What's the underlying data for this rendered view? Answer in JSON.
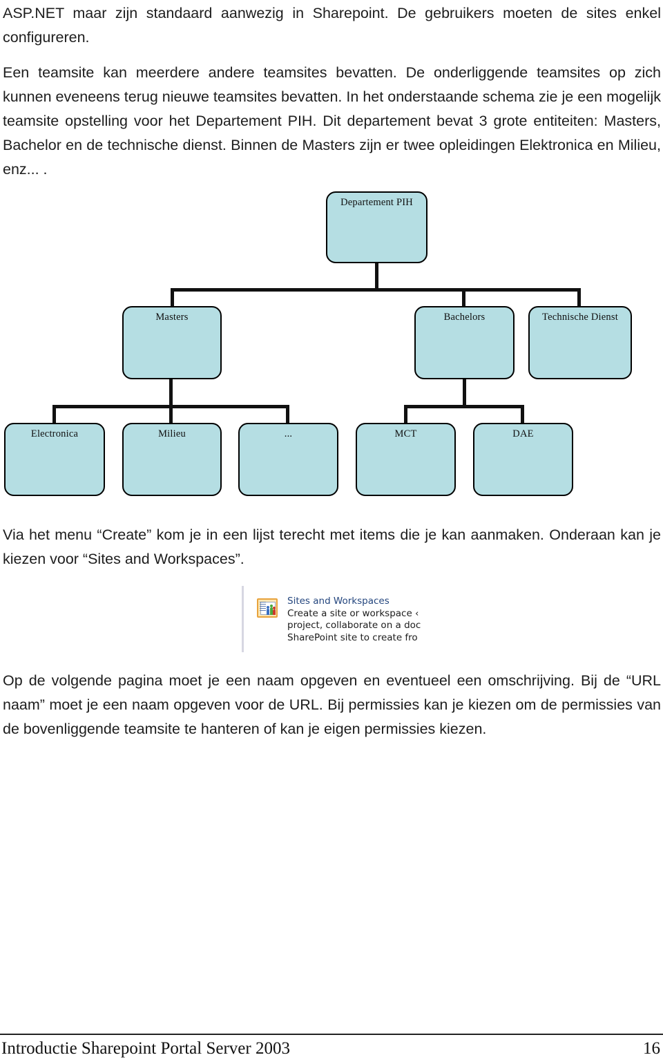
{
  "document": {
    "paragraphs": {
      "p1": "ASP.NET maar zijn standaard aanwezig in Sharepoint. De gebruikers moeten de sites enkel configureren.",
      "p2": "Een teamsite kan meerdere andere teamsites bevatten. De onderliggende teamsites op zich kunnen eveneens terug nieuwe teamsites bevatten. In het onderstaande schema zie je een mogelijk teamsite opstelling voor het Departement PIH. Dit departement bevat 3 grote entiteiten: Masters, Bachelor en de technische dienst. Binnen de Masters zijn er twee opleidingen Elektronica en Milieu, enz... .",
      "p3": "Via het menu “Create” kom je in een lijst terecht met items die je kan aanmaken. Onderaan kan je kiezen voor “Sites and Workspaces”.",
      "p4": "Op de volgende pagina moet je een naam opgeven en eventueel een omschrijving. Bij de “URL naam” moet je een naam opgeven voor de URL. Bij permissies kan je kiezen om de permissies van de bovenliggende teamsite te hanteren of kan je eigen permissies kiezen."
    },
    "footer": {
      "title": "Introductie Sharepoint Portal Server 2003",
      "page_number": "16"
    }
  },
  "org_chart": {
    "colors": {
      "node_fill": "#b5dee3",
      "node_border": "#000000",
      "edge": "#111111"
    },
    "nodes": {
      "root": "Departement PIH",
      "masters": "Masters",
      "bachelors": "Bachelors",
      "technische_dienst": "Technische Dienst",
      "electronica": "Electronica",
      "milieu": "Milieu",
      "ellipsis": "...",
      "mct": "MCT",
      "dae": "DAE"
    }
  },
  "sharepoint_screenshot": {
    "icon_name": "sites-and-workspaces-icon",
    "title": "Sites and Workspaces",
    "description_line_1": "Create a site or workspace ‹",
    "description_line_2": "project, collaborate on a doc",
    "description_line_3": "SharePoint site to create fro",
    "colors": {
      "icon_border": "#e8a33d",
      "icon_fill": "#fbe6b4",
      "title_color": "#24467e"
    }
  }
}
